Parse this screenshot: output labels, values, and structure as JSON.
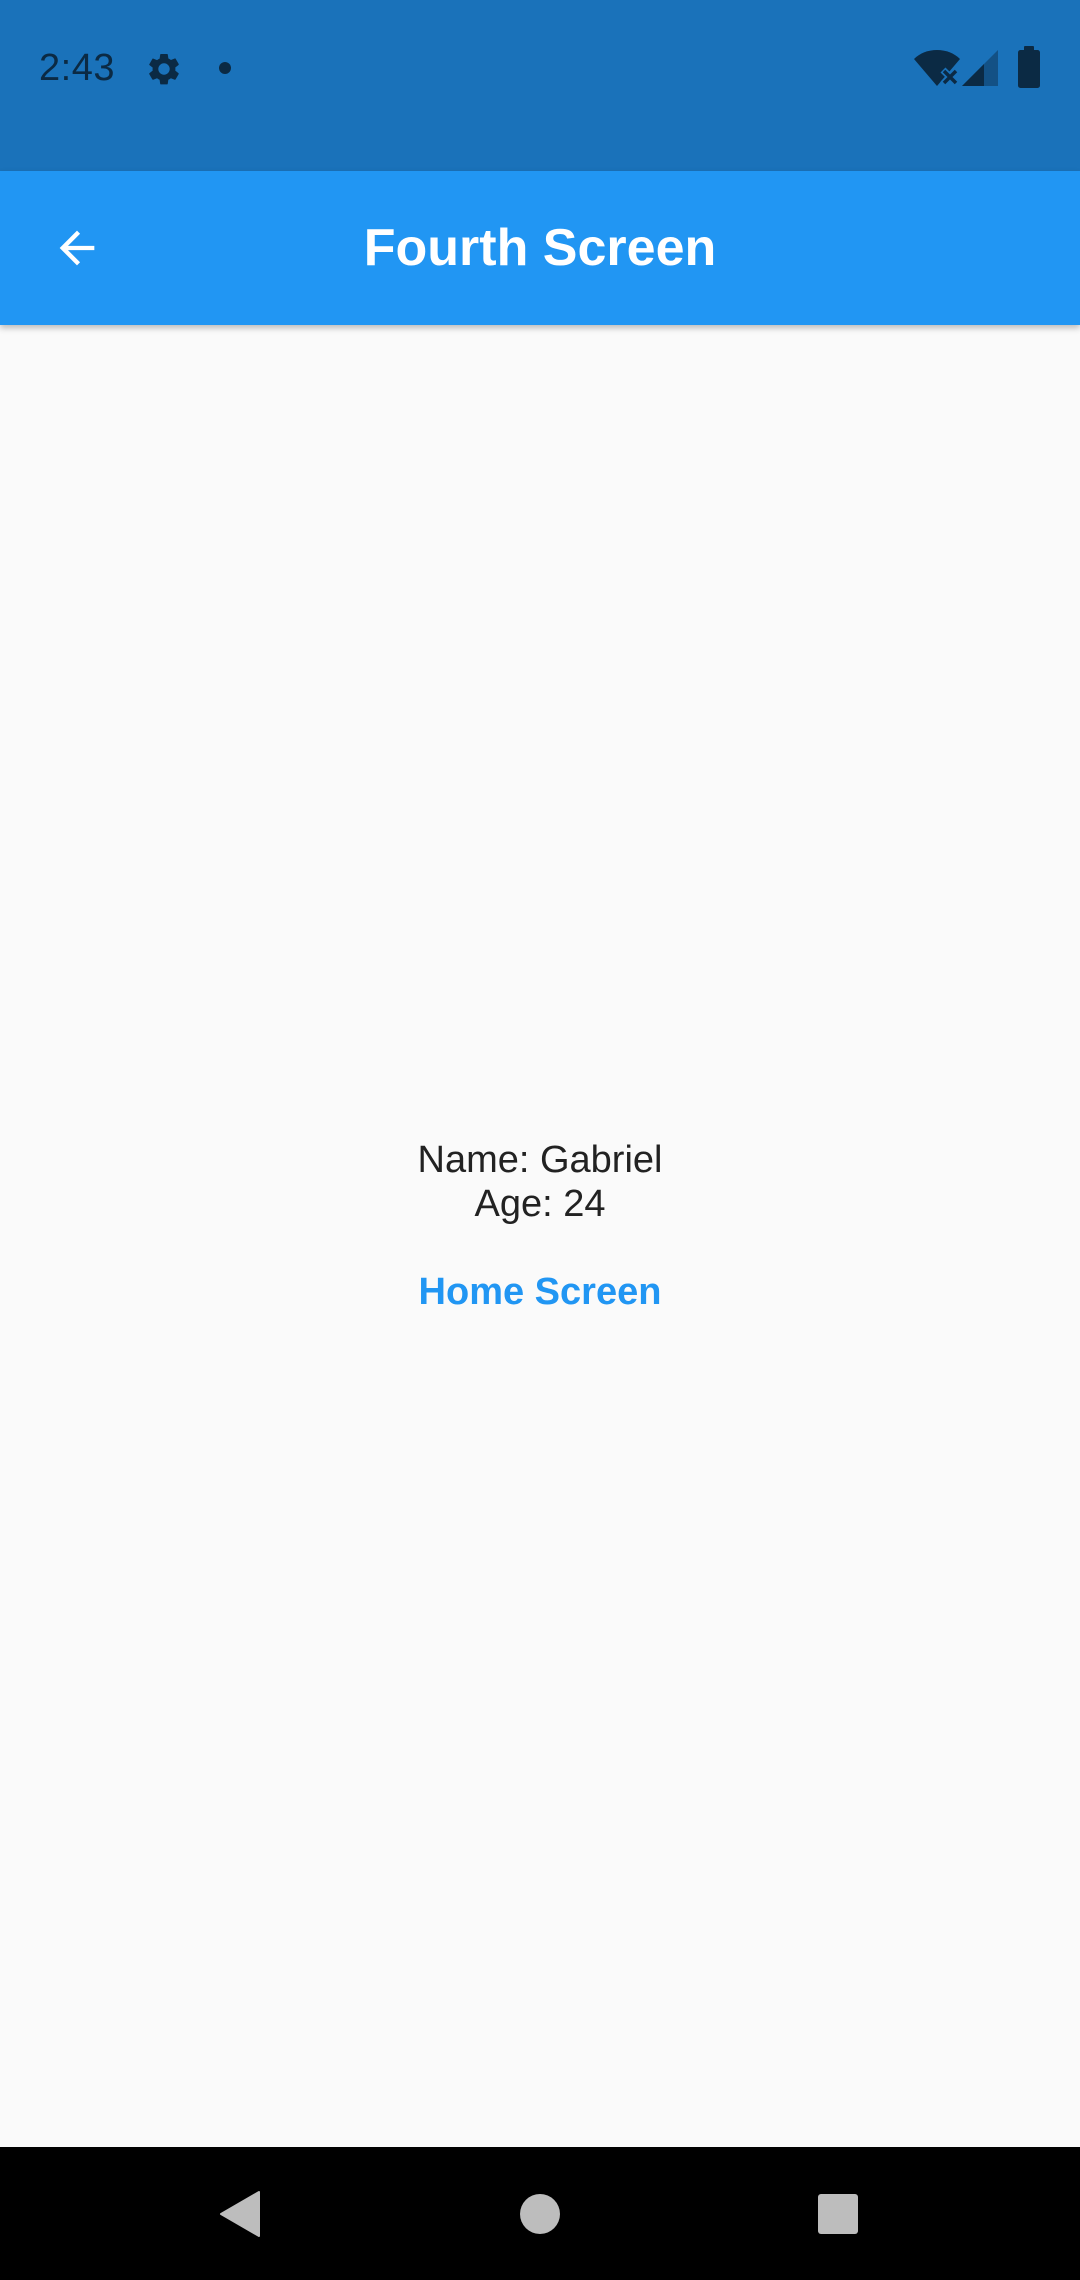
{
  "status_bar": {
    "time": "2:43",
    "background_color": "#1A72BA",
    "icons": [
      "gear-icon",
      "notification-dot-icon",
      "wifi-off-icon",
      "signal-icon",
      "battery-icon"
    ]
  },
  "app_bar": {
    "title": "Fourth Screen",
    "back_icon": "arrow-left-icon",
    "background_color": "#2196F3"
  },
  "content": {
    "name_line": "Name: Gabriel",
    "age_line": "Age: 24",
    "home_button_label": "Home Screen",
    "link_color": "#2196F3"
  },
  "nav_bar": {
    "buttons": [
      "back-triangle-icon",
      "home-circle-icon",
      "recents-square-icon"
    ]
  }
}
